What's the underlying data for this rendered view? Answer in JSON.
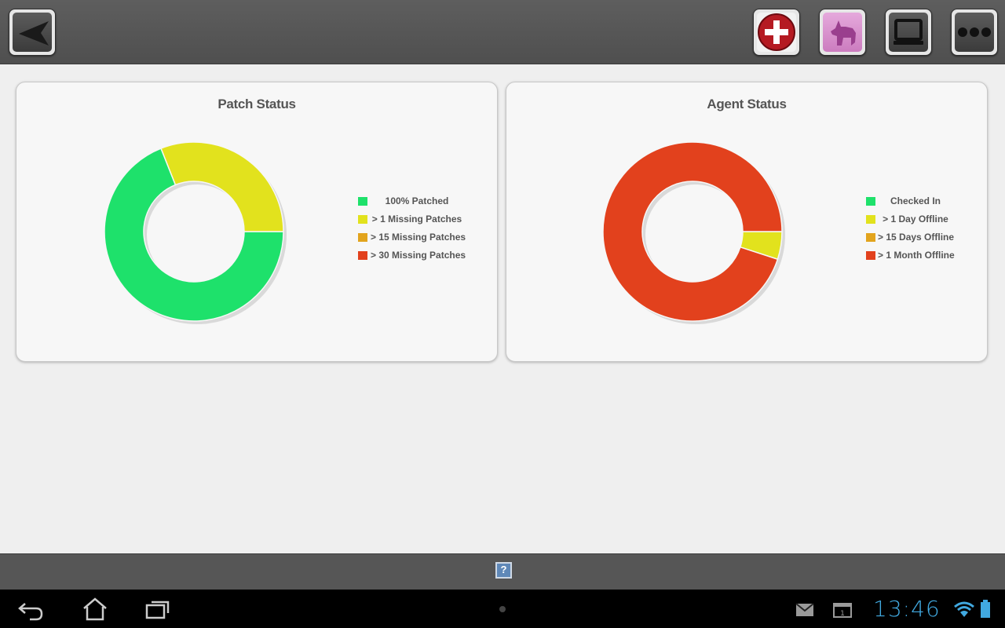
{
  "toolbar": {
    "back_icon": "back-arrow-icon",
    "add_icon": "plus-circle-icon",
    "dog_icon": "dog-icon",
    "device_icon": "monitor-icon",
    "more_icon": "more-dots-icon"
  },
  "cards": [
    {
      "title": "Patch Status",
      "legend": [
        {
          "label": "100% Patched",
          "color": "#1ee16b"
        },
        {
          "label": "> 1 Missing Patches",
          "color": "#e2e21d"
        },
        {
          "label": "> 15 Missing Patches",
          "color": "#e2a41d"
        },
        {
          "label": "> 30 Missing Patches",
          "color": "#e2411d"
        }
      ]
    },
    {
      "title": "Agent Status",
      "legend": [
        {
          "label": "Checked In",
          "color": "#1ee16b"
        },
        {
          "label": "> 1 Day Offline",
          "color": "#e2e21d"
        },
        {
          "label": "> 15 Days Offline",
          "color": "#e2a41d"
        },
        {
          "label": "> 1 Month Offline",
          "color": "#e2411d"
        }
      ]
    }
  ],
  "chart_data": [
    {
      "type": "pie",
      "title": "Patch Status",
      "categories": [
        "100% Patched",
        "> 1 Missing Patches",
        "> 15 Missing Patches",
        "> 30 Missing Patches"
      ],
      "values": [
        69,
        31,
        0,
        0
      ],
      "colors": [
        "#1ee16b",
        "#e2e21d",
        "#e2a41d",
        "#e2411d"
      ],
      "legend": "right"
    },
    {
      "type": "pie",
      "title": "Agent Status",
      "categories": [
        "Checked In",
        "> 1 Day Offline",
        "> 15 Days Offline",
        "> 1 Month Offline"
      ],
      "values": [
        0,
        5,
        0,
        95
      ],
      "colors": [
        "#1ee16b",
        "#e2e21d",
        "#e2a41d",
        "#e2411d"
      ],
      "legend": "right"
    }
  ],
  "bottombar": {
    "help_label": "?"
  },
  "statusbar": {
    "time": "13:46"
  }
}
